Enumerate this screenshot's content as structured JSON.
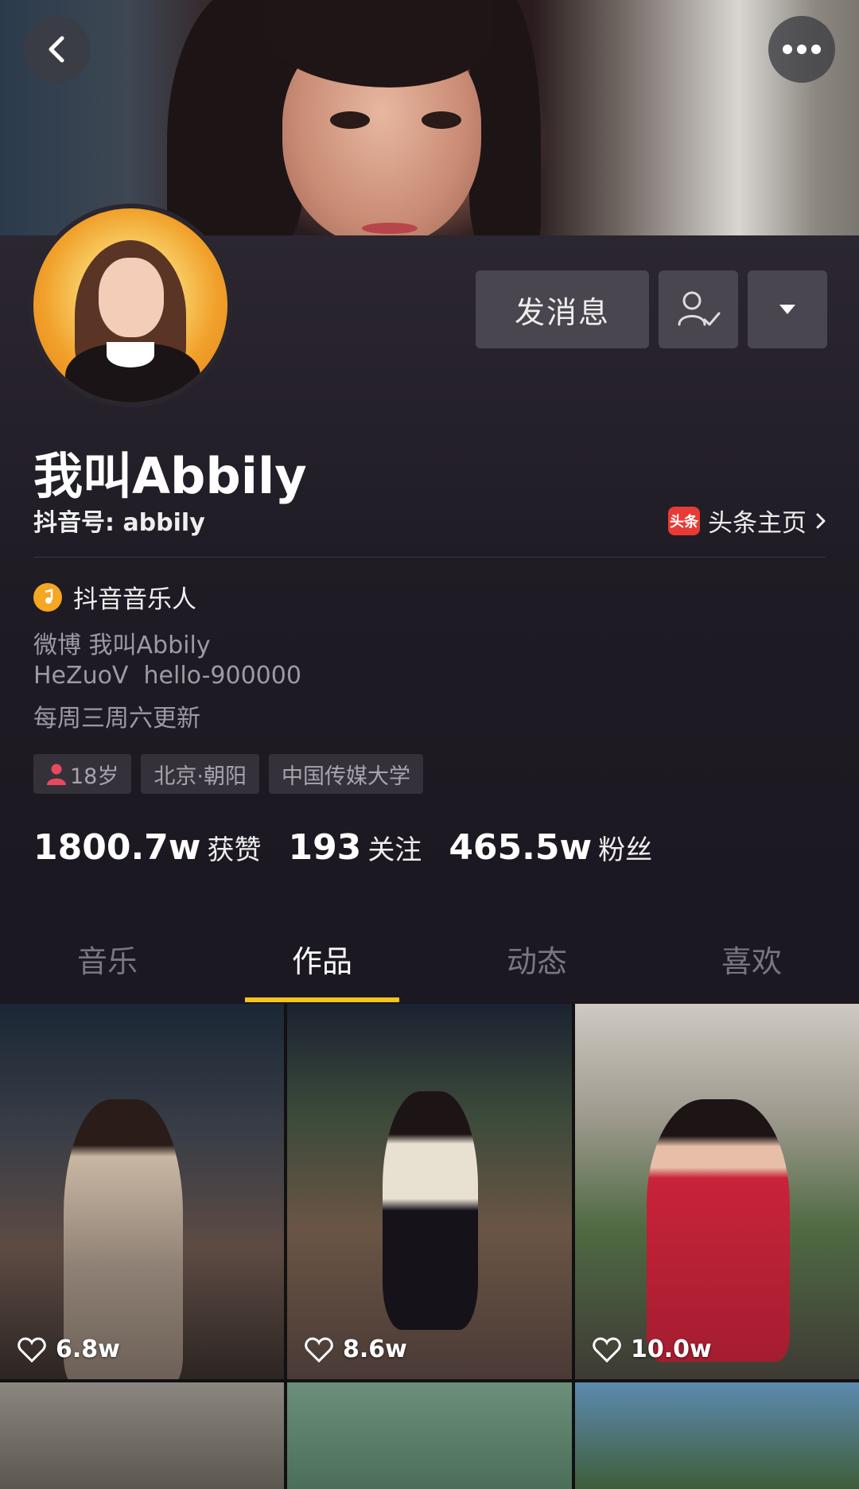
{
  "header": {
    "back_icon": "chevron-left-icon",
    "more_icon": "more-horizontal-icon"
  },
  "actions": {
    "message_label": "发消息",
    "follow_icon": "user-check-icon",
    "dropdown_icon": "caret-down-icon"
  },
  "profile": {
    "name": "我叫Abbily",
    "douyin_id": "抖音号: abbily",
    "toutiao_badge": "头条",
    "toutiao_link": "头条主页",
    "verify_label": "抖音音乐人",
    "bio_lines": [
      "微博 我叫Abbily",
      "HeZuoV  hello-900000",
      "每周三周六更新"
    ],
    "tags": [
      "18岁",
      "北京·朝阳",
      "中国传媒大学"
    ]
  },
  "stats": [
    {
      "value": "1800.7w",
      "label": "获赞"
    },
    {
      "value": "193",
      "label": "关注"
    },
    {
      "value": "465.5w",
      "label": "粉丝"
    }
  ],
  "tabs": [
    "音乐",
    "作品",
    "动态",
    "喜欢"
  ],
  "active_tab": "作品",
  "videos": [
    {
      "likes": "6.8w"
    },
    {
      "likes": "8.6w"
    },
    {
      "likes": "10.0w"
    }
  ],
  "colors": {
    "accent": "#f5c518",
    "background": "#1b1821",
    "toutiao_red": "#e83b35",
    "verify_orange": "#f5a623"
  }
}
